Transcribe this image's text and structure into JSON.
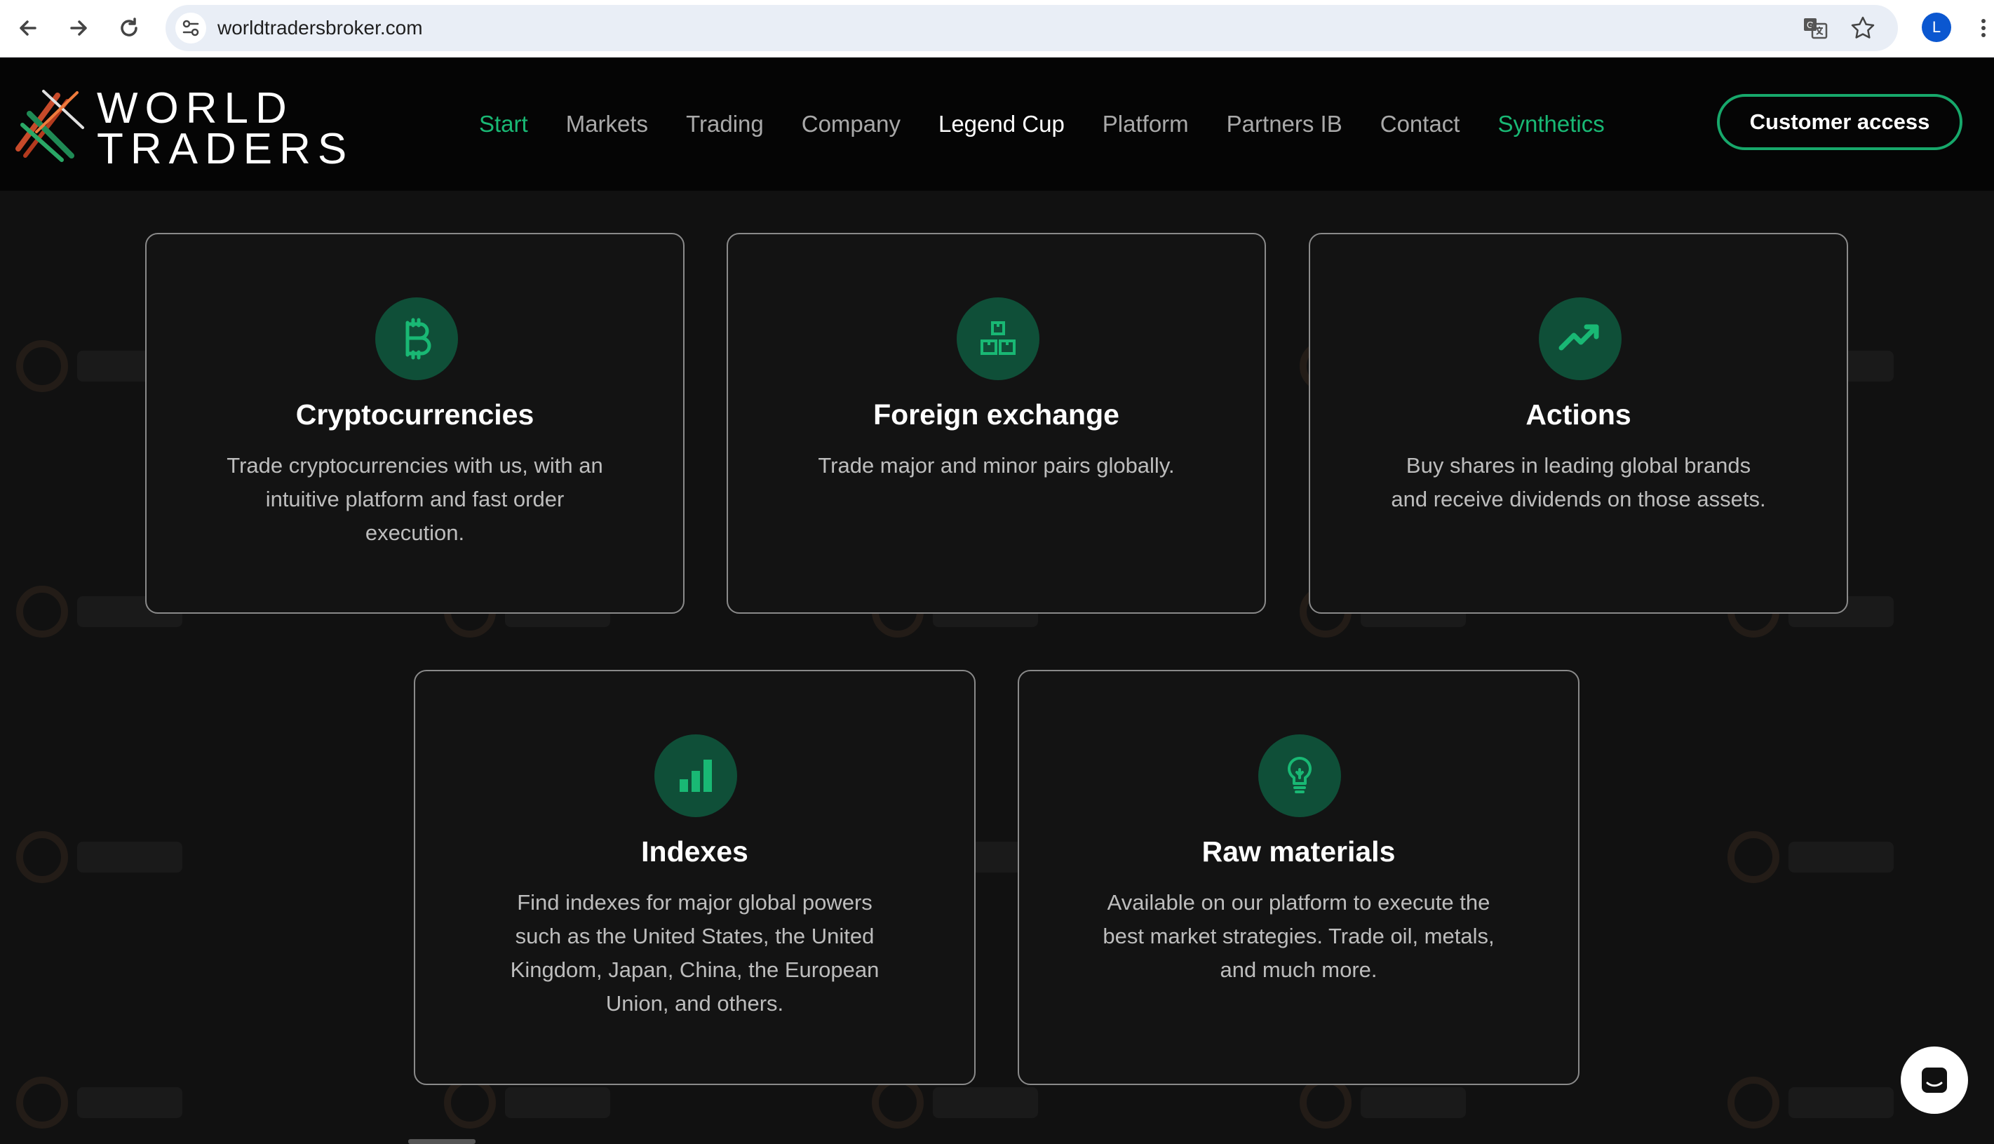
{
  "browser": {
    "url": "worldtradersbroker.com",
    "profile_initial": "L",
    "icons": [
      "back-arrow-icon",
      "forward-arrow-icon",
      "reload-icon",
      "site-info-icon",
      "translate-icon",
      "bookmark-star-icon",
      "more-menu-icon"
    ]
  },
  "header": {
    "logo_line1": "WORLD",
    "logo_line2": "TRADERS",
    "nav": [
      {
        "label": "Start"
      },
      {
        "label": "Markets"
      },
      {
        "label": "Trading"
      },
      {
        "label": "Company"
      },
      {
        "label": "Legend Cup"
      },
      {
        "label": "Platform"
      },
      {
        "label": "Partners IB"
      },
      {
        "label": "Contact"
      },
      {
        "label": "Synthetics"
      }
    ],
    "cta": "Customer access",
    "colors": {
      "accent": "#19b874",
      "background": "#050505"
    }
  },
  "cards": [
    {
      "title": "Cryptocurrencies",
      "icon": "bitcoin-icon",
      "desc": [
        "Trade cryptocurrencies with us, with an",
        "intuitive platform and fast order",
        "execution."
      ]
    },
    {
      "title": "Foreign exchange",
      "icon": "boxes-icon",
      "desc": [
        "Trade major and minor pairs globally."
      ]
    },
    {
      "title": "Actions",
      "icon": "trending-up-icon",
      "desc": [
        "Buy shares in leading global brands",
        "and receive dividends on those assets."
      ]
    },
    {
      "title": "Indexes",
      "icon": "bar-chart-icon",
      "desc": [
        "Find indexes for major global powers",
        "such as the United States, the United",
        "Kingdom, Japan, China, the European",
        "Union, and others."
      ]
    },
    {
      "title": "Raw materials",
      "icon": "lightbulb-icon",
      "desc": [
        "Available on our platform to execute the",
        "best market strategies. Trade oil, metals,",
        "and much more."
      ]
    }
  ],
  "colors": {
    "page_bg": "#111111",
    "card_border": "#8a8a8a",
    "icon_bg": "#0f4f38",
    "icon_fg": "#19b874"
  }
}
